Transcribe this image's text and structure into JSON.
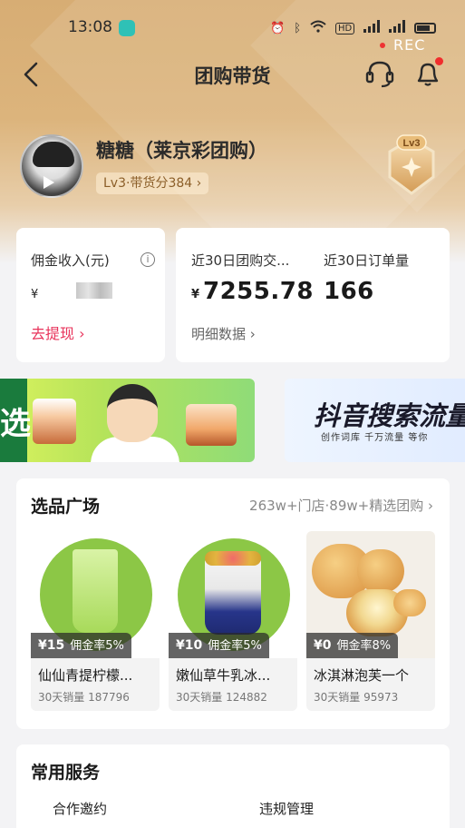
{
  "status_bar": {
    "time": "13:08",
    "rec_label": "REC"
  },
  "nav": {
    "title": "团购带货"
  },
  "profile": {
    "name": "糖糖（莱京彩团购）",
    "level_tag": "Lv3·带货分384 ›",
    "badge_label": "Lv3"
  },
  "stats": {
    "commission_label": "佣金收入(元)",
    "commission_currency": "¥",
    "withdraw_label": "去提现 ›",
    "gmv_label": "近30日团购交...",
    "gmv_currency": "¥",
    "gmv_value": "7255.78",
    "orders_label": "近30日订单量",
    "orders_value": "166",
    "detail_label": "明细数据 ›"
  },
  "banners": {
    "left_text": "选",
    "right_title": "抖音搜索流量",
    "right_subtitle": "创作词库  千万流量  等你"
  },
  "marketplace": {
    "title": "选品广场",
    "more": "263w+门店·89w+精选团购",
    "products": [
      {
        "price": "¥15",
        "rate": "佣金率5%",
        "name": "仙仙青提柠檬...",
        "sales": "30天销量 187796",
        "color": "#8cc746"
      },
      {
        "price": "¥10",
        "rate": "佣金率5%",
        "name": "嫩仙草牛乳冰...",
        "sales": "30天销量 124882",
        "color": "#8cc746"
      },
      {
        "price": "¥0",
        "rate": "佣金率8%",
        "name": "冰淇淋泡芙一个",
        "sales": "30天销量 95973",
        "color": "#f0c27a"
      }
    ]
  },
  "services": {
    "title": "常用服务",
    "items": [
      "合作邀约",
      "违规管理"
    ]
  },
  "colors": {
    "accent_red": "#e8325a",
    "header_gold": "#d7ad74"
  }
}
